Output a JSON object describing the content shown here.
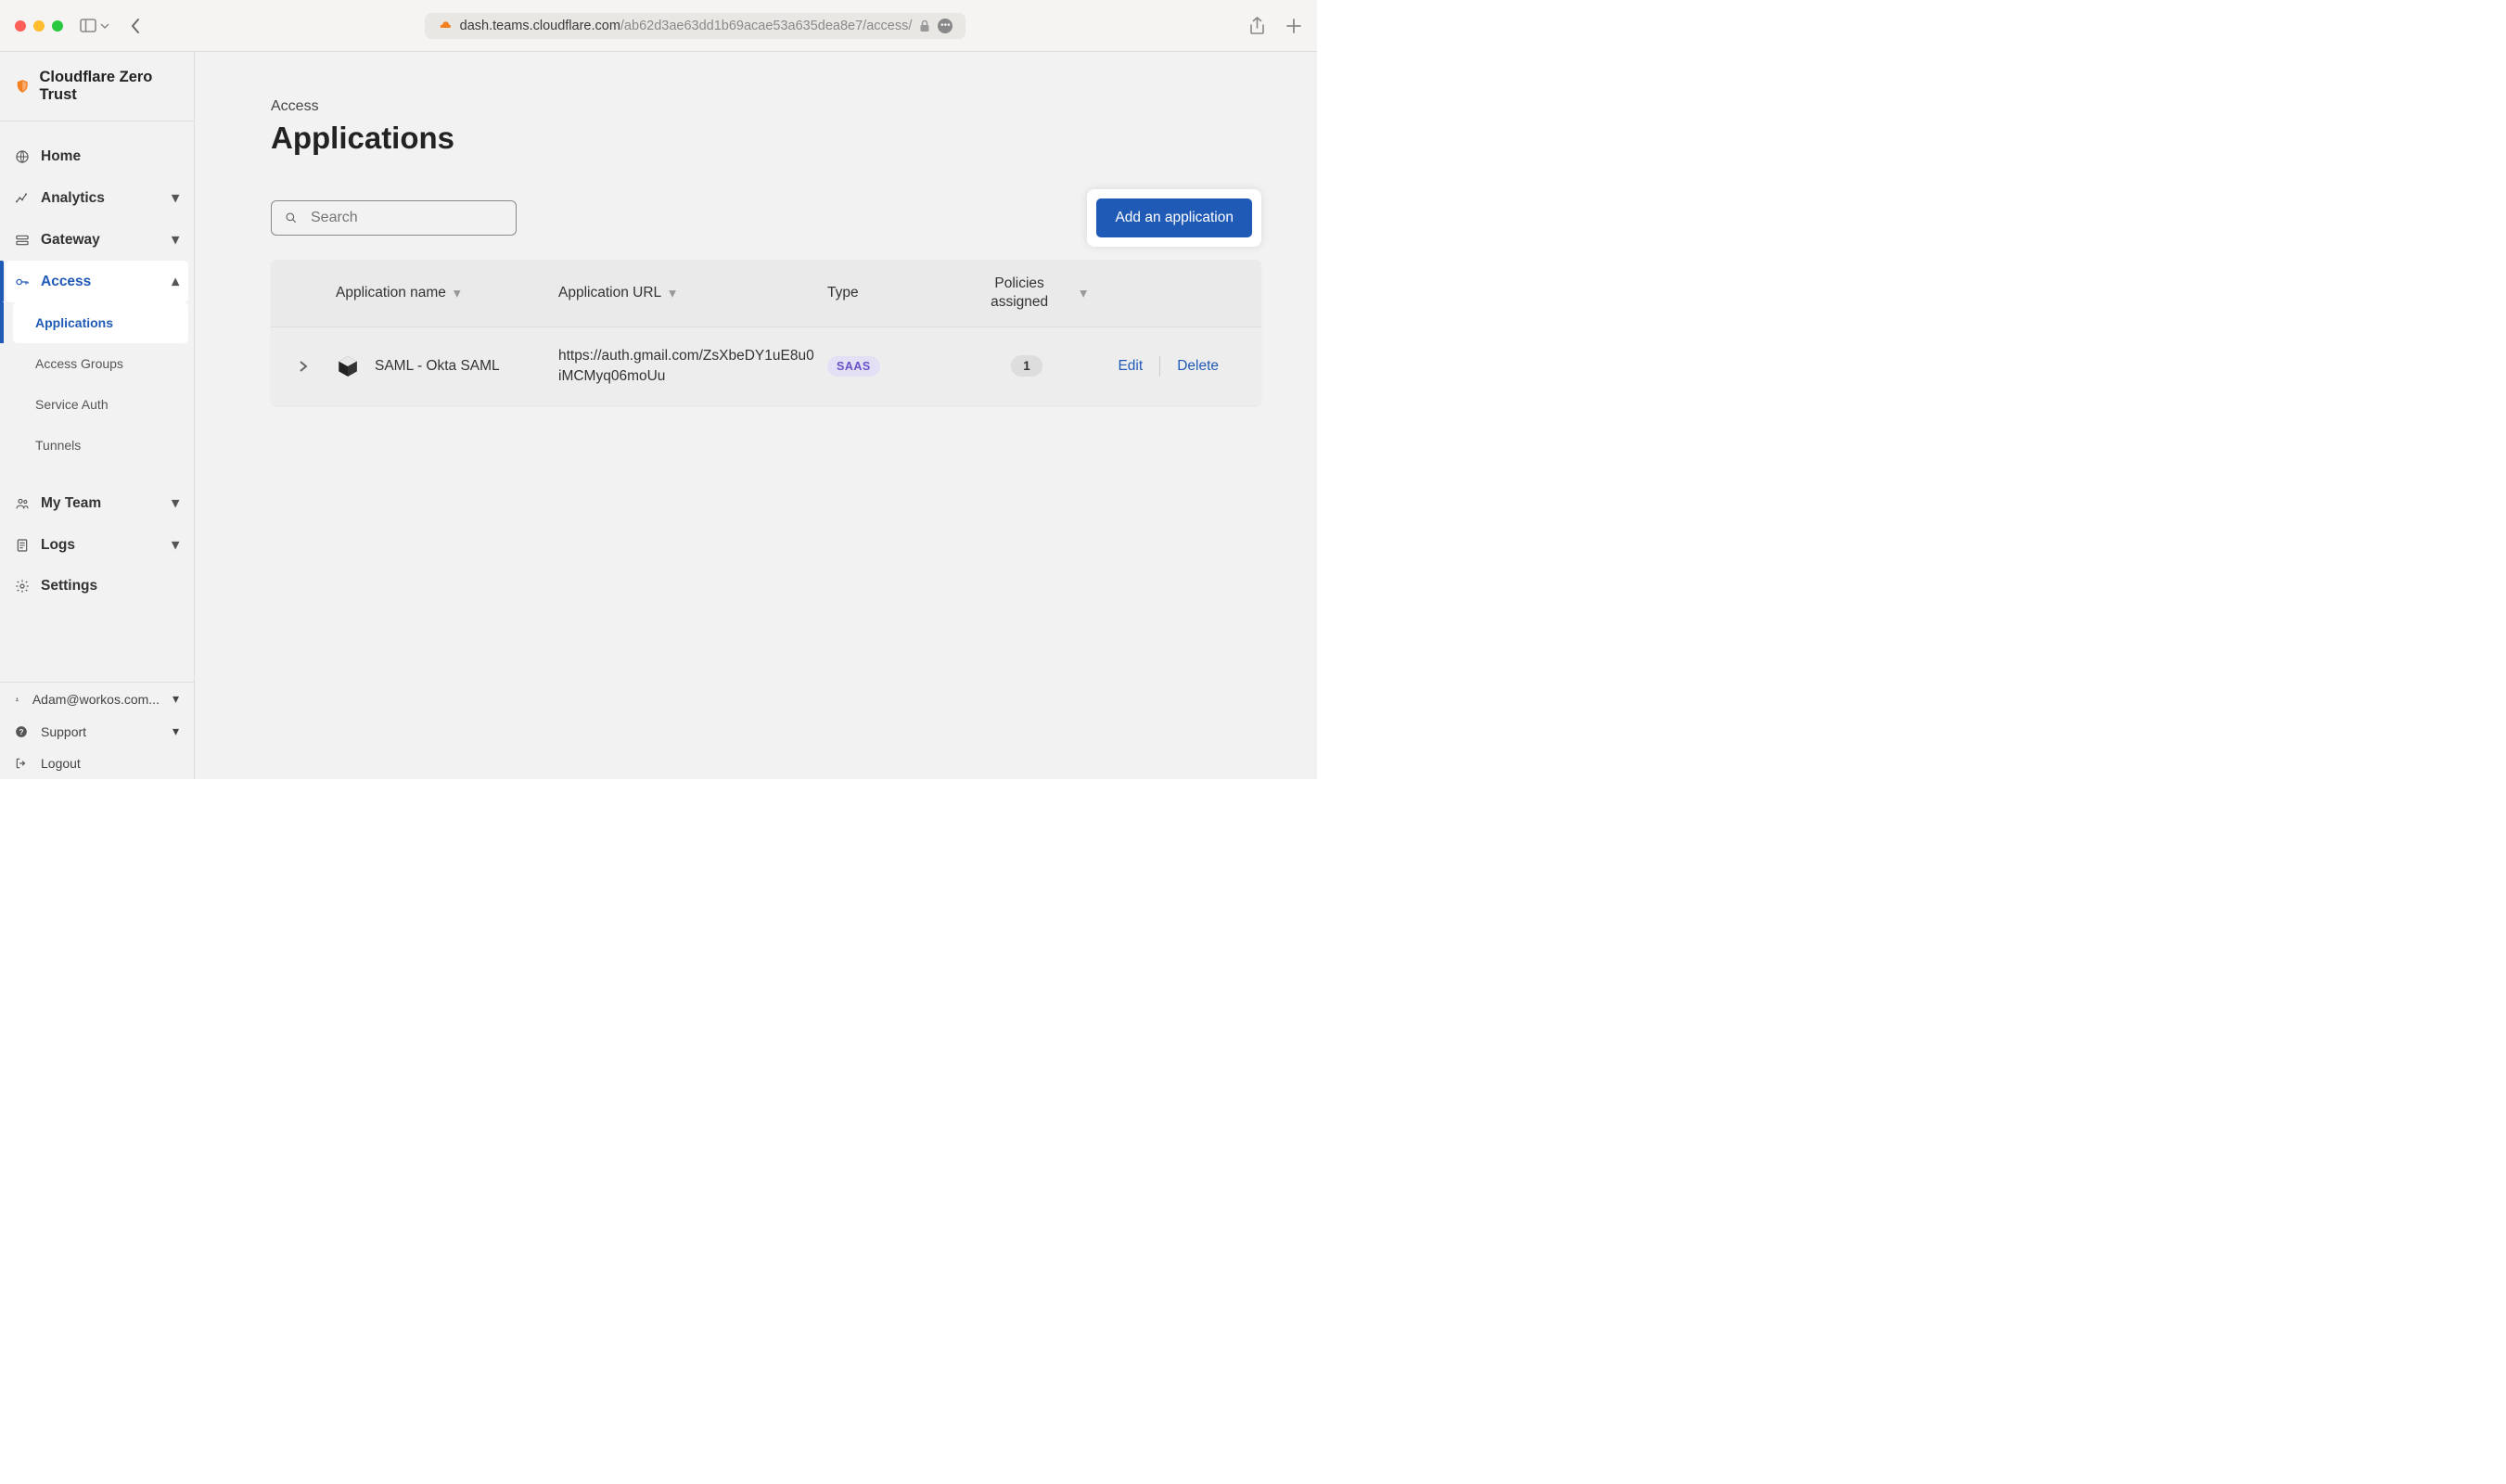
{
  "browser": {
    "url_host": "dash.teams.cloudflare.com",
    "url_path": "/ab62d3ae63dd1b69acae53a635dea8e7/access/"
  },
  "brand": {
    "title": "Cloudflare Zero Trust"
  },
  "nav": {
    "home": "Home",
    "analytics": "Analytics",
    "gateway": "Gateway",
    "access": "Access",
    "myteam": "My Team",
    "logs": "Logs",
    "settings": "Settings"
  },
  "subnav": {
    "applications": "Applications",
    "access_groups": "Access Groups",
    "service_auth": "Service Auth",
    "tunnels": "Tunnels"
  },
  "footer": {
    "user": "Adam@workos.com...",
    "support": "Support",
    "logout": "Logout"
  },
  "page": {
    "breadcrumb": "Access",
    "title": "Applications"
  },
  "search": {
    "placeholder": "Search"
  },
  "buttons": {
    "add": "Add an application"
  },
  "table": {
    "headers": {
      "name": "Application name",
      "url": "Application URL",
      "type": "Type",
      "policies": "Policies assigned"
    },
    "rows": [
      {
        "name": "SAML - Okta SAML",
        "url": "https://auth.gmail.com/ZsXbeDY1uE8u0iMCMyq06moUu",
        "type": "SAAS",
        "policies": "1",
        "edit": "Edit",
        "delete": "Delete"
      }
    ]
  }
}
